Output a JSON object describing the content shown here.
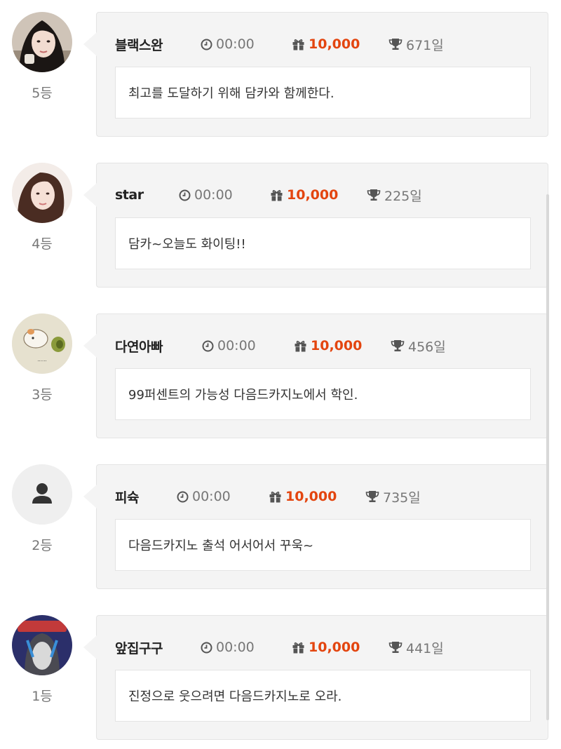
{
  "entries": [
    {
      "rank": "5등",
      "nickname": "블랙스완",
      "time": "00:00",
      "gift": "10,000",
      "days": "671일",
      "message": "최고를 도달하기 위해 담카와 함께한다."
    },
    {
      "rank": "4등",
      "nickname": "star",
      "time": "00:00",
      "gift": "10,000",
      "days": "225일",
      "message": "담카~오늘도 화이팅!!"
    },
    {
      "rank": "3등",
      "nickname": "다연아빠",
      "time": "00:00",
      "gift": "10,000",
      "days": "456일",
      "message": "99퍼센트의 가능성 다음드카지노에서 학인."
    },
    {
      "rank": "2등",
      "nickname": "피슉",
      "time": "00:00",
      "gift": "10,000",
      "days": "735일",
      "message": "다음드카지노 출석 어서어서 꾸욱~"
    },
    {
      "rank": "1등",
      "nickname": "앞집구구",
      "time": "00:00",
      "gift": "10,000",
      "days": "441일",
      "message": "진정으로 웃으려면 다음드카지노로 오라."
    }
  ],
  "avatars": [
    "photo-woman-dark-hair",
    "photo-woman-long-hair",
    "hamster-cartoon",
    "default-user-icon",
    "cartoon-character"
  ],
  "colors": {
    "gift_accent": "#e3450f",
    "card_bg": "#f4f4f4",
    "card_border": "#e4e4e4",
    "muted_text": "#777777"
  }
}
